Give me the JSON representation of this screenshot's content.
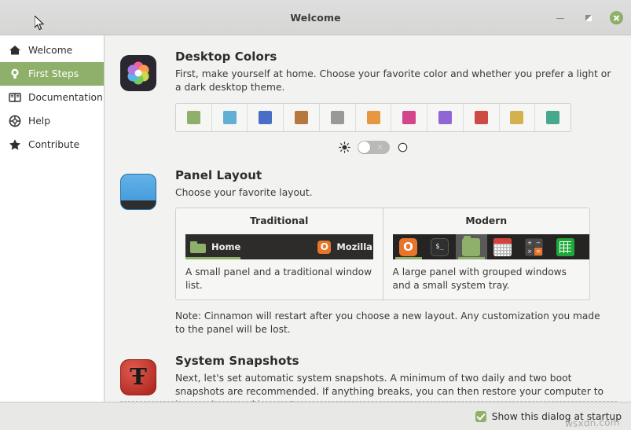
{
  "window": {
    "title": "Welcome",
    "controls": {
      "minimize_label": "Minimize",
      "maximize_label": "Restore",
      "close_label": "Close"
    }
  },
  "sidebar": {
    "items": [
      {
        "id": "welcome",
        "label": "Welcome",
        "icon": "home-icon",
        "active": false
      },
      {
        "id": "first-steps",
        "label": "First Steps",
        "icon": "bulb-icon",
        "active": true
      },
      {
        "id": "documentation",
        "label": "Documentation",
        "icon": "book-icon",
        "active": false
      },
      {
        "id": "help",
        "label": "Help",
        "icon": "lifering-icon",
        "active": false
      },
      {
        "id": "contribute",
        "label": "Contribute",
        "icon": "star-icon",
        "active": false
      }
    ]
  },
  "sections": {
    "desktop_colors": {
      "icon": "desktop-colors-icon",
      "title": "Desktop Colors",
      "description": "First, make yourself at home. Choose your favorite color and whether you prefer a light or a dark desktop theme.",
      "swatches": [
        {
          "name": "green",
          "color": "#8fb06a"
        },
        {
          "name": "blue",
          "color": "#63aed4"
        },
        {
          "name": "indigo",
          "color": "#4a6ec7"
        },
        {
          "name": "brown",
          "color": "#b5793f"
        },
        {
          "name": "grey",
          "color": "#999997"
        },
        {
          "name": "orange",
          "color": "#e6973f"
        },
        {
          "name": "pink",
          "color": "#d4468c"
        },
        {
          "name": "purple",
          "color": "#8f66d4"
        },
        {
          "name": "red",
          "color": "#cf4a42"
        },
        {
          "name": "yellow",
          "color": "#d4b14f"
        },
        {
          "name": "teal",
          "color": "#46a98e"
        }
      ],
      "theme_toggle": {
        "light_icon": "sun-icon",
        "dark_icon": "moon-icon",
        "state": "off",
        "off_mark": "×"
      }
    },
    "panel_layout": {
      "icon": "panel-layout-icon",
      "title": "Panel Layout",
      "description": "Choose your favorite layout.",
      "options": [
        {
          "id": "traditional",
          "name": "Traditional",
          "description": "A small panel and a traditional window list.",
          "preview_tasks": [
            {
              "label": "Home",
              "icon": "folder-icon",
              "selected": true
            },
            {
              "label": "Mozilla",
              "icon": "firefox-icon",
              "selected": false
            }
          ]
        },
        {
          "id": "modern",
          "name": "Modern",
          "description": "A large panel with grouped windows and a small system tray.",
          "preview_icons": [
            "firefox-icon",
            "terminal-icon",
            "files-icon",
            "calendar-icon",
            "calculator-icon",
            "spreadsheet-icon"
          ]
        }
      ],
      "note": "Note: Cinnamon will restart after you choose a new layout. Any customization you made to the panel will be lost."
    },
    "system_snapshots": {
      "icon": "timeshift-icon",
      "icon_glyph": "Ŧ",
      "title": "System Snapshots",
      "description": "Next, let's set automatic system snapshots. A minimum of two daily and two boot snapshots are recommended. If anything breaks, you can then restore your computer to its previous working state."
    }
  },
  "footer": {
    "show_at_startup": {
      "label": "Show this dialog at startup",
      "checked": true
    },
    "watermark": "wsxdn.com"
  },
  "theme": {
    "accent": "#8fb06a",
    "titlebar_bg": "#dadad8",
    "content_bg": "#f2f2f0",
    "sidebar_bg": "#ffffff",
    "footer_bg": "#e8e8e6"
  }
}
